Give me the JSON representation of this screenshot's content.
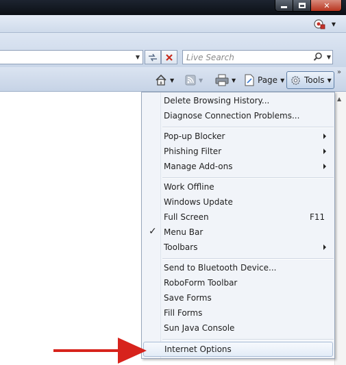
{
  "window": {
    "minimize_icon": "minimize-icon",
    "restore_icon": "restore-icon",
    "close_label": "✕"
  },
  "tabstrip": {
    "icon": "ie-options-icon"
  },
  "address_bar": {
    "refresh_icon": "refresh-arrows-icon",
    "stop_icon": "stop-x-icon"
  },
  "search": {
    "placeholder": "Live Search"
  },
  "command_bar": {
    "page_label": "Page",
    "tools_label": "Tools",
    "overflow": "»"
  },
  "tools_menu": {
    "items": [
      {
        "label": "Delete Browsing History..."
      },
      {
        "label": "Diagnose Connection Problems..."
      },
      {
        "label": "Pop-up Blocker",
        "submenu": true
      },
      {
        "label": "Phishing Filter",
        "submenu": true
      },
      {
        "label": "Manage Add-ons",
        "submenu": true
      },
      {
        "label": "Work Offline"
      },
      {
        "label": "Windows Update"
      },
      {
        "label": "Full Screen",
        "shortcut": "F11"
      },
      {
        "label": "Menu Bar",
        "checked": true,
        "check": "✓"
      },
      {
        "label": "Toolbars",
        "submenu": true
      },
      {
        "label": "Send to Bluetooth Device..."
      },
      {
        "label": "RoboForm Toolbar"
      },
      {
        "label": "Save Forms"
      },
      {
        "label": "Fill Forms"
      },
      {
        "label": "Sun Java Console"
      },
      {
        "label": "Internet Options",
        "highlighted": true
      }
    ]
  },
  "colors": {
    "annotation_arrow": "#d7231c",
    "menu_background": "#f1f4f9",
    "chrome_blue": "#c9d6e8"
  }
}
